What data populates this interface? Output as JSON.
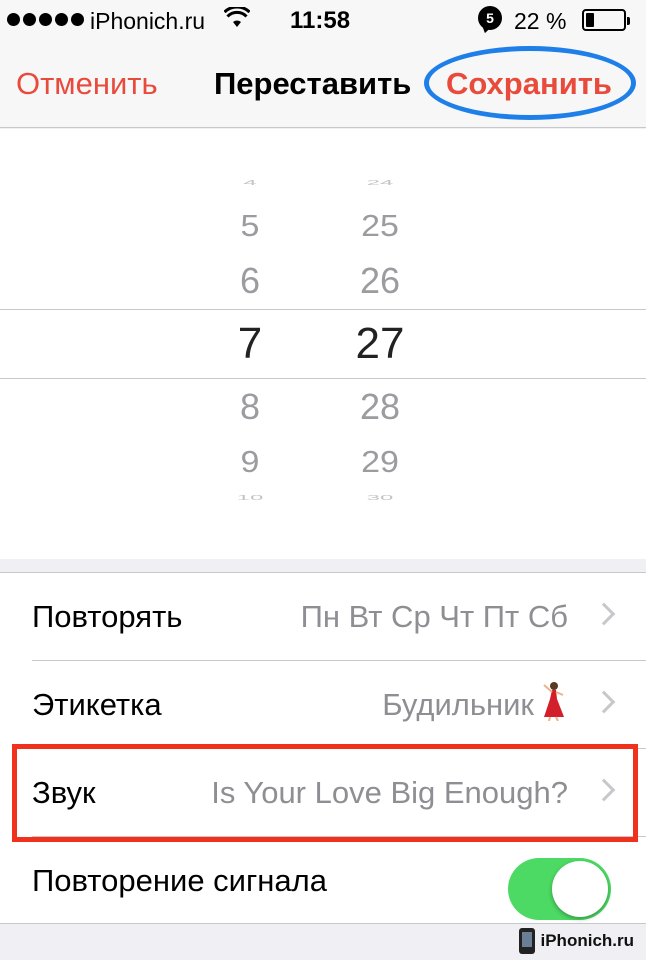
{
  "status_bar": {
    "carrier": "iPhonich.ru",
    "time": "11:58",
    "message_badge": "5",
    "battery_percent": "22 %",
    "battery_level": 0.22,
    "icons": [
      "signal-dots-icon",
      "wifi-icon",
      "message-badge-icon",
      "battery-icon"
    ]
  },
  "nav": {
    "cancel_label": "Отменить",
    "title": "Переставить",
    "save_label": "Сохранить",
    "accent_color": "#e84b3c",
    "highlight_color": "#1f7fe8"
  },
  "picker": {
    "hours": [
      "4",
      "5",
      "6",
      "7",
      "8",
      "9",
      "10"
    ],
    "minutes": [
      "24",
      "25",
      "26",
      "27",
      "28",
      "29",
      "30"
    ],
    "selected_hour": "7",
    "selected_minute": "27"
  },
  "settings": {
    "repeat": {
      "label": "Повторять",
      "value": "Пн Вт Ср Чт Пт Сб"
    },
    "label_row": {
      "label": "Этикетка",
      "value": "Будильник"
    },
    "sound": {
      "label": "Звук",
      "value": "Is Your Love Big Enough?",
      "highlight_color": "#f0321c"
    },
    "snooze": {
      "label": "Повторение сигнала",
      "enabled": true,
      "toggle_color": "#4cd964"
    }
  },
  "watermark": {
    "text": "iPhonich.ru"
  }
}
